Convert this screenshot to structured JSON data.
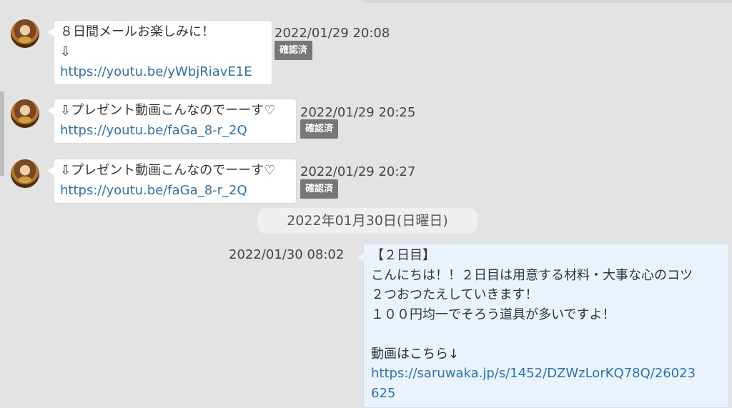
{
  "messages_in": [
    {
      "lines": [
        "８日間メールお楽しみに！",
        "⇩"
      ],
      "link": "https://youtu.be/yWbjRiavE1E",
      "time": "2022/01/29 20:08",
      "status": "確認済"
    },
    {
      "lines": [
        "⇩プレゼント動画こんなのでーーす♡"
      ],
      "link": "https://youtu.be/faGa_8-r_2Q",
      "time": "2022/01/29 20:25",
      "status": "確認済"
    },
    {
      "lines": [
        "⇩プレゼント動画こんなのでーーす♡"
      ],
      "link": "https://youtu.be/faGa_8-r_2Q",
      "time": "2022/01/29 20:27",
      "status": "確認済"
    }
  ],
  "date_separator": "2022年01月30日(日曜日)",
  "message_out": {
    "time": "2022/01/30 08:02",
    "lines": [
      "【２日目】",
      "こんにちは！！２日目は用意する材料・大事な心のコツ",
      "２つおつたえしていきます！",
      "１００円均一でそろう道具が多いですよ！",
      "",
      "動画はこちら↓"
    ],
    "link_line1": "https://saruwaka.jp/s/1452/DZWzLorKQ78Q/26023",
    "link_line2": "625"
  }
}
